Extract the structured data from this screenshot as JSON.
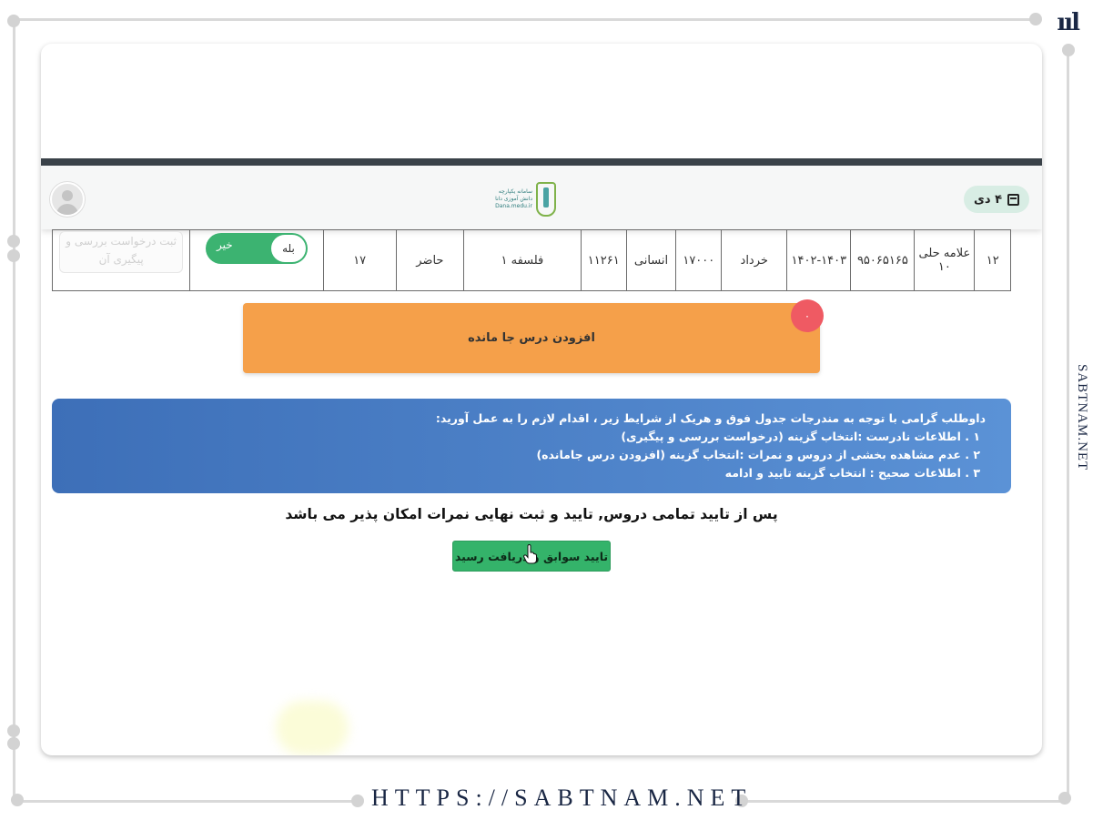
{
  "watermark": {
    "corner_logo": "ııl",
    "side_text": "SABTNAM.NET",
    "footer_url": "HTTPS://SABTNAM.NET"
  },
  "header": {
    "date": "۴ دی",
    "logo_text": "سامانه یکپارچه دانش آموزی دانا Dana.medu.ir"
  },
  "table_row": {
    "cells": [
      "۱۲",
      "علامه حلی ۱۰",
      "۹۵۰۶۵۱۶۵",
      "۱۴۰۲-۱۴۰۳",
      "خرداد",
      "۱۷۰۰۰",
      "انسانی",
      "۱۱۲۶۱",
      "فلسفه ۱",
      "حاضر",
      "۱۷"
    ],
    "toggle_on_label": "بله",
    "toggle_off_label": "خیر",
    "pending_button": "ثبت درخواست بررسی و پیگیری آن"
  },
  "add_missing": {
    "label": "افزودن درس جا مانده",
    "badge": "۰"
  },
  "info": {
    "lines": [
      "داوطلب گرامی با توجه به مندرجات جدول فوق و هریک از شرایط زیر ، اقدام لازم را به عمل آورید:",
      "۱ . اطلاعات نادرست :انتخاب گزینه (درخواست بررسی و پیگیری)",
      "۲ . عدم مشاهده بخشی از دروس و نمرات :انتخاب گزینه (افزودن درس جامانده)",
      "۳ . اطلاعات صحیح : انتخاب گزینه تایید و ادامه"
    ]
  },
  "final_note": "پس از تایید تمامی دروس, تایید و ثبت نهایی نمرات امکان پذیر می باشد",
  "confirm_button": "تایید سوابق و دریافت رسید",
  "colors": {
    "orange": "#f5a04a",
    "blue_start": "#3d6fb8",
    "blue_end": "#5b92d6",
    "green": "#34b36a",
    "badge_red": "#ef5a63"
  }
}
